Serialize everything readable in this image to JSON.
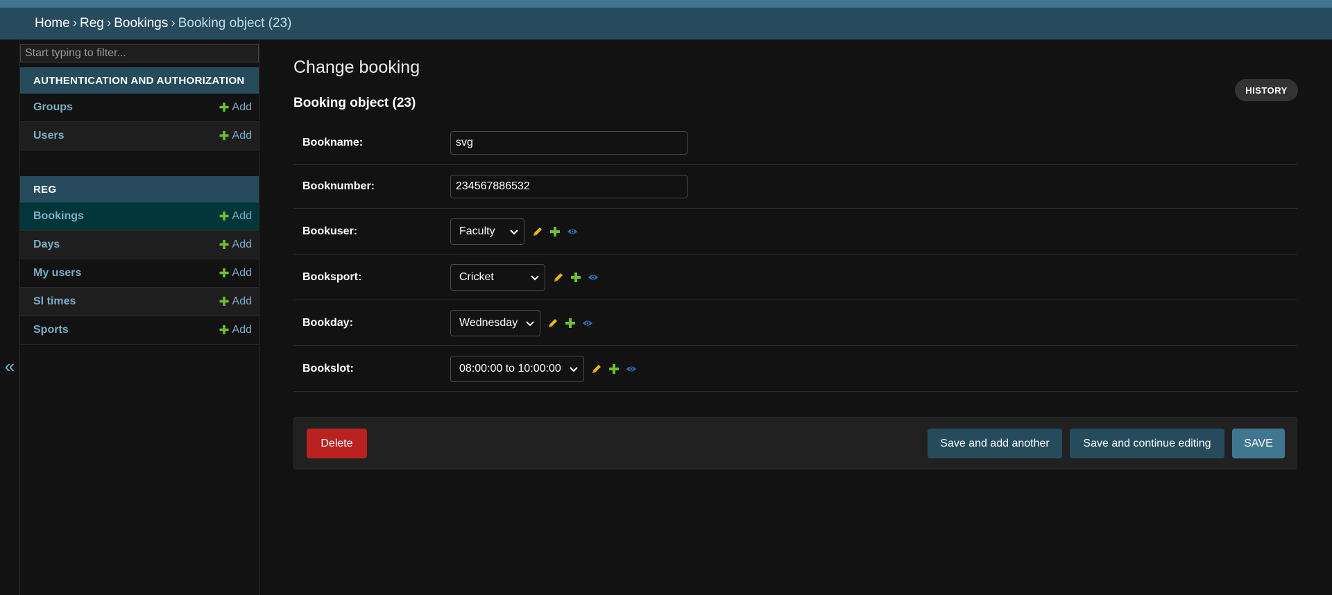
{
  "breadcrumbs": {
    "home": "Home",
    "sep": "›",
    "app": "Reg",
    "model": "Bookings",
    "current": "Booking object (23)"
  },
  "sidebar": {
    "collapse_label": "«",
    "filter_placeholder": "Start typing to filter...",
    "modules": [
      {
        "title": "AUTHENTICATION AND AUTHORIZATION",
        "items": [
          {
            "label": "Groups",
            "add": "Add"
          },
          {
            "label": "Users",
            "add": "Add"
          }
        ]
      },
      {
        "title": "REG",
        "items": [
          {
            "label": "Bookings",
            "add": "Add"
          },
          {
            "label": "Days",
            "add": "Add"
          },
          {
            "label": "My users",
            "add": "Add"
          },
          {
            "label": "Sl times",
            "add": "Add"
          },
          {
            "label": "Sports",
            "add": "Add"
          }
        ]
      }
    ]
  },
  "main": {
    "page_title": "Change booking",
    "history_label": "HISTORY",
    "object_title": "Booking object (23)",
    "fields": {
      "bookname": {
        "label": "Bookname:",
        "value": "svg"
      },
      "booknumber": {
        "label": "Booknumber:",
        "value": "234567886532"
      },
      "bookuser": {
        "label": "Bookuser:",
        "selected": "Faculty"
      },
      "booksport": {
        "label": "Booksport:",
        "selected": "Cricket"
      },
      "bookday": {
        "label": "Bookday:",
        "selected": "Wednesday"
      },
      "bookslot": {
        "label": "Bookslot:",
        "selected": "08:00:00 to 10:00:00"
      }
    },
    "buttons": {
      "delete": "Delete",
      "save_add_another": "Save and add another",
      "save_continue": "Save and continue editing",
      "save": "SAVE"
    }
  },
  "colors": {
    "header_bg": "#264b5d",
    "top_strip": "#417690",
    "link": "#79aec8",
    "add_plus": "#70bf2b",
    "edit_pencil": "#efb80b",
    "view_eye": "#2f6db1",
    "delete_bg": "#ba2121",
    "save_bg": "#417690",
    "active_row": "#00363a"
  },
  "icons": {
    "edit": "pencil-icon",
    "add": "plus-icon",
    "view": "eye-icon",
    "dropdown": "chevron-down-icon"
  }
}
